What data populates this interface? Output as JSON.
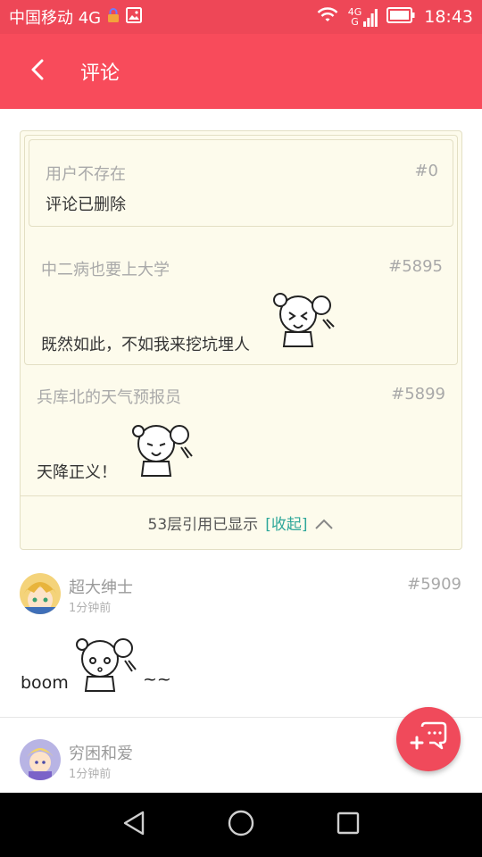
{
  "status_bar": {
    "carrier": "中国移动 4G",
    "signal_label_top": "4G",
    "signal_label_bottom": "G",
    "time": "18:43"
  },
  "header": {
    "title": "评论"
  },
  "quote_chain": {
    "quotes": [
      {
        "user": "用户不存在",
        "floor": "#0",
        "text": "评论已删除"
      },
      {
        "user": "中二病也要上大学",
        "floor": "#5895",
        "text": "既然如此，不如我来挖坑埋人"
      },
      {
        "user": "兵库北的天气预报员",
        "floor": "#5899",
        "text": "天降正义！"
      }
    ],
    "footer_text": "53层引用已显示",
    "collapse_label": "[收起]"
  },
  "comments": [
    {
      "user": "超大绅士",
      "time": "1分钟前",
      "floor": "#5909",
      "text_before": "boom",
      "text_after": "~~"
    },
    {
      "user": "穷困和爱",
      "time": "1分钟前"
    }
  ],
  "colors": {
    "accent": "#f84b5b",
    "status_bar": "#ee4757",
    "quote_bg": "#fdfbec",
    "link": "#2fa79a"
  },
  "icons": {
    "back": "back-arrow-icon",
    "fab": "add-comment-icon",
    "nav_back": "triangle-back-icon",
    "nav_home": "circle-home-icon",
    "nav_recents": "square-recents-icon"
  }
}
